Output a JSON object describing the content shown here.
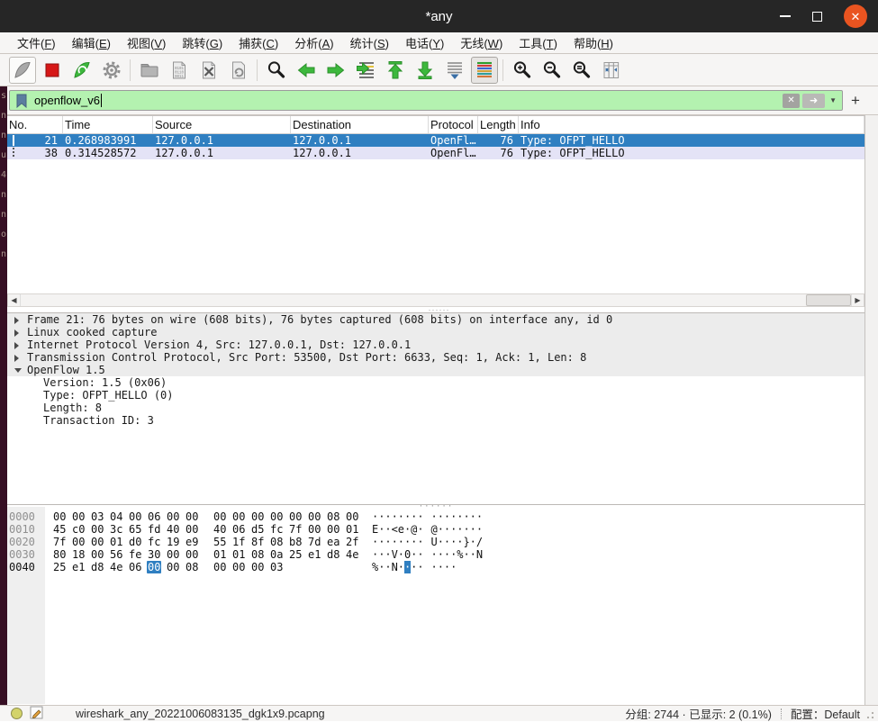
{
  "window": {
    "title": "*any"
  },
  "menu": {
    "items": [
      {
        "text": "文件",
        "mnemonic": "F"
      },
      {
        "text": "编辑",
        "mnemonic": "E"
      },
      {
        "text": "视图",
        "mnemonic": "V"
      },
      {
        "text": "跳转",
        "mnemonic": "G"
      },
      {
        "text": "捕获",
        "mnemonic": "C"
      },
      {
        "text": "分析",
        "mnemonic": "A"
      },
      {
        "text": "统计",
        "mnemonic": "S"
      },
      {
        "text": "电话",
        "mnemonic": "Y"
      },
      {
        "text": "无线",
        "mnemonic": "W"
      },
      {
        "text": "工具",
        "mnemonic": "T"
      },
      {
        "text": "帮助",
        "mnemonic": "H"
      }
    ]
  },
  "toolbar": {
    "buttons": [
      {
        "icon": "wireshark-fin",
        "name": "capture-start-button",
        "state": "framed-disabled"
      },
      {
        "icon": "stop-square",
        "name": "capture-stop-button",
        "state": ""
      },
      {
        "icon": "restart-fin",
        "name": "capture-restart-button",
        "state": ""
      },
      {
        "icon": "gear",
        "name": "capture-options-button",
        "state": ""
      },
      {
        "sep": true
      },
      {
        "icon": "folder",
        "name": "file-open-button",
        "state": ""
      },
      {
        "icon": "save-doc",
        "name": "file-save-button",
        "state": ""
      },
      {
        "icon": "close-doc",
        "name": "file-close-button",
        "state": ""
      },
      {
        "icon": "reload",
        "name": "reload-button",
        "state": ""
      },
      {
        "sep": true
      },
      {
        "icon": "magnifier",
        "name": "find-packet-button",
        "state": ""
      },
      {
        "icon": "arrow-left",
        "name": "previous-packet-button",
        "state": ""
      },
      {
        "icon": "arrow-right",
        "name": "next-packet-button",
        "state": ""
      },
      {
        "icon": "goto-lines",
        "name": "go-to-packet-button",
        "state": ""
      },
      {
        "icon": "arrow-up-bar",
        "name": "first-packet-button",
        "state": ""
      },
      {
        "icon": "arrow-down-bar",
        "name": "last-packet-button",
        "state": ""
      },
      {
        "icon": "autoscroll",
        "name": "auto-scroll-button",
        "state": ""
      },
      {
        "icon": "colorize",
        "name": "colorize-button",
        "state": "checked"
      },
      {
        "sep": true
      },
      {
        "icon": "zoom-in",
        "name": "zoom-in-button",
        "state": ""
      },
      {
        "icon": "zoom-out",
        "name": "zoom-out-button",
        "state": ""
      },
      {
        "icon": "zoom-orig",
        "name": "zoom-original-button",
        "state": ""
      },
      {
        "icon": "resize-columns",
        "name": "resize-columns-button",
        "state": ""
      }
    ]
  },
  "filter": {
    "value": "openflow_v6",
    "add_label": "+"
  },
  "packet_list": {
    "columns": [
      "No.",
      "Time",
      "Source",
      "Destination",
      "Protocol",
      "Length",
      "Info"
    ],
    "rows": [
      {
        "no": "21",
        "time": "0.268983991",
        "source": "127.0.0.1",
        "destination": "127.0.0.1",
        "protocol": "OpenFl…",
        "length": "76",
        "info": "Type: OFPT_HELLO",
        "selected": true
      },
      {
        "no": "38",
        "time": "0.314528572",
        "source": "127.0.0.1",
        "destination": "127.0.0.1",
        "protocol": "OpenFl…",
        "length": "76",
        "info": "Type: OFPT_HELLO",
        "selected": false
      }
    ]
  },
  "details": {
    "rows": [
      {
        "arrow": "collapsed",
        "indent": 0,
        "shaded": true,
        "text": "Frame 21: 76 bytes on wire (608 bits), 76 bytes captured (608 bits) on interface any, id 0"
      },
      {
        "arrow": "collapsed",
        "indent": 0,
        "shaded": true,
        "text": "Linux cooked capture"
      },
      {
        "arrow": "collapsed",
        "indent": 0,
        "shaded": true,
        "text": "Internet Protocol Version 4, Src: 127.0.0.1, Dst: 127.0.0.1"
      },
      {
        "arrow": "collapsed",
        "indent": 0,
        "shaded": true,
        "text": "Transmission Control Protocol, Src Port: 53500, Dst Port: 6633, Seq: 1, Ack: 1, Len: 8"
      },
      {
        "arrow": "expanded",
        "indent": 0,
        "shaded": true,
        "text": "OpenFlow 1.5"
      },
      {
        "arrow": "none",
        "indent": 1,
        "shaded": false,
        "text": "Version: 1.5 (0x06)"
      },
      {
        "arrow": "none",
        "indent": 1,
        "shaded": false,
        "text": "Type: OFPT_HELLO (0)"
      },
      {
        "arrow": "none",
        "indent": 1,
        "shaded": false,
        "text": "Length: 8"
      },
      {
        "arrow": "none",
        "indent": 1,
        "shaded": false,
        "text": "Transaction ID: 3"
      }
    ]
  },
  "hex": {
    "rows": [
      {
        "offset": "0000",
        "bytes": [
          "00",
          "00",
          "03",
          "04",
          "00",
          "06",
          "00",
          "00",
          "00",
          "00",
          "00",
          "00",
          "00",
          "00",
          "08",
          "00"
        ],
        "ascii": "················"
      },
      {
        "offset": "0010",
        "bytes": [
          "45",
          "c0",
          "00",
          "3c",
          "65",
          "fd",
          "40",
          "00",
          "40",
          "06",
          "d5",
          "fc",
          "7f",
          "00",
          "00",
          "01"
        ],
        "ascii": "E··<e·@·@·······"
      },
      {
        "offset": "0020",
        "bytes": [
          "7f",
          "00",
          "00",
          "01",
          "d0",
          "fc",
          "19",
          "e9",
          "55",
          "1f",
          "8f",
          "08",
          "b8",
          "7d",
          "ea",
          "2f"
        ],
        "ascii": "········U····}·/"
      },
      {
        "offset": "0030",
        "bytes": [
          "80",
          "18",
          "00",
          "56",
          "fe",
          "30",
          "00",
          "00",
          "01",
          "01",
          "08",
          "0a",
          "25",
          "e1",
          "d8",
          "4e"
        ],
        "ascii": "···V·0······%··N"
      },
      {
        "offset": "0040",
        "bytes": [
          "25",
          "e1",
          "d8",
          "4e",
          "06",
          "00",
          "00",
          "08",
          "00",
          "00",
          "00",
          "03"
        ],
        "ascii": "%··N········"
      }
    ],
    "selected": {
      "row": 4,
      "byte": 5
    }
  },
  "status": {
    "filename": "wireshark_any_20221006083135_dgk1x9.pcapng",
    "packets": "分组: 2744 · 已显示: 2 (0.1%)",
    "profile": "配置：Default"
  },
  "background_strip": {
    "glyphs": [
      "s",
      "n",
      "n",
      "u",
      "4",
      "n",
      "n",
      "o",
      "n"
    ]
  },
  "colors": {
    "titlebar": "#262626",
    "close_button": "#e95420",
    "filter_valid_bg": "#b4f2b0",
    "selected_row": "#2f7fc1",
    "tcp_row": "#e4e3f6",
    "toolbar_green": "#3db83d",
    "hex_highlight": "#2f7fc1"
  }
}
